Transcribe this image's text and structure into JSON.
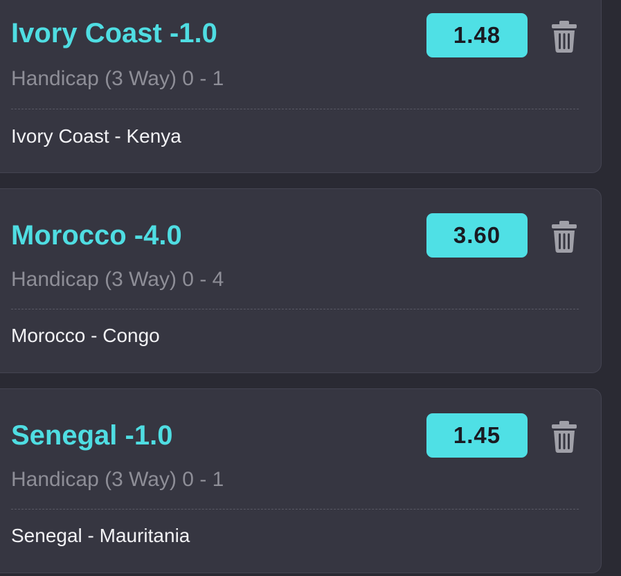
{
  "bets": [
    {
      "selection": "Ivory Coast -1.0",
      "market": "Handicap (3 Way) 0 - 1",
      "event": "Ivory Coast - Kenya",
      "odds": "1.48",
      "delete_icon": "trash-icon"
    },
    {
      "selection": "Morocco -4.0",
      "market": "Handicap (3 Way) 0 - 4",
      "event": "Morocco - Congo",
      "odds": "3.60",
      "delete_icon": "trash-icon"
    },
    {
      "selection": "Senegal -1.0",
      "market": "Handicap (3 Way) 0 - 1",
      "event": "Senegal - Mauritania",
      "odds": "1.45",
      "delete_icon": "trash-icon"
    }
  ],
  "colors": {
    "background": "#2a2a33",
    "card": "#363641",
    "accent": "#4fe0e5",
    "muted_text": "#8e8e97",
    "event_text": "#f2f2f5",
    "icon": "#a0a0a8"
  }
}
